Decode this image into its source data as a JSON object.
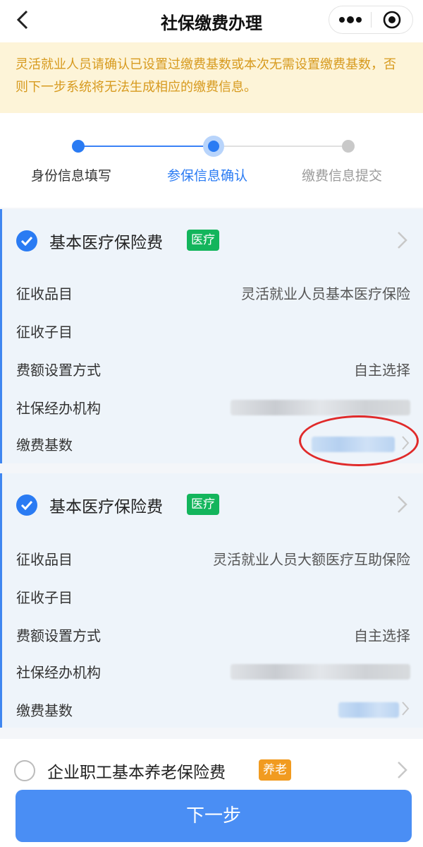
{
  "header": {
    "title": "社保缴费办理"
  },
  "notice": {
    "text": "灵活就业人员请确认已设置过缴费基数或本次无需设置缴费基数，否则下一步系统将无法生成相应的缴费信息。"
  },
  "steps": [
    {
      "label": "身份信息填写",
      "state": "done"
    },
    {
      "label": "参保信息确认",
      "state": "current"
    },
    {
      "label": "缴费信息提交",
      "state": "pending"
    }
  ],
  "cards": [
    {
      "title": "基本医疗保险费",
      "tag": "医疗",
      "checked": true,
      "rows": [
        {
          "label": "征收品目",
          "value": "灵活就业人员基本医疗保险"
        },
        {
          "label": "征收子目",
          "value": ""
        },
        {
          "label": "费额设置方式",
          "value": "自主选择"
        },
        {
          "label": "社保经办机构",
          "value": ""
        },
        {
          "label": "缴费基数",
          "value": ""
        }
      ]
    },
    {
      "title": "基本医疗保险费",
      "tag": "医疗",
      "checked": true,
      "rows": [
        {
          "label": "征收品目",
          "value": "灵活就业人员大额医疗互助保险"
        },
        {
          "label": "征收子目",
          "value": ""
        },
        {
          "label": "费额设置方式",
          "value": "自主选择"
        },
        {
          "label": "社保经办机构",
          "value": ""
        },
        {
          "label": "缴费基数",
          "value": ""
        }
      ]
    },
    {
      "title": "企业职工基本养老保险费",
      "tag": "养老",
      "checked": false
    }
  ],
  "footer": {
    "next_label": "下一步"
  },
  "colors": {
    "accent": "#2a7bf3",
    "tag_medical": "#13b55c",
    "tag_pension": "#f19b20",
    "notice_text": "#d79a1e",
    "notice_bg": "#fdf4d8",
    "highlight_ellipse": "#e02a2a"
  },
  "icons": {
    "back": "chevron-left-icon",
    "more": "more-dots-icon",
    "close": "target-circle-icon",
    "check": "check-circle-icon",
    "row_arrow": "chevron-right-icon"
  }
}
